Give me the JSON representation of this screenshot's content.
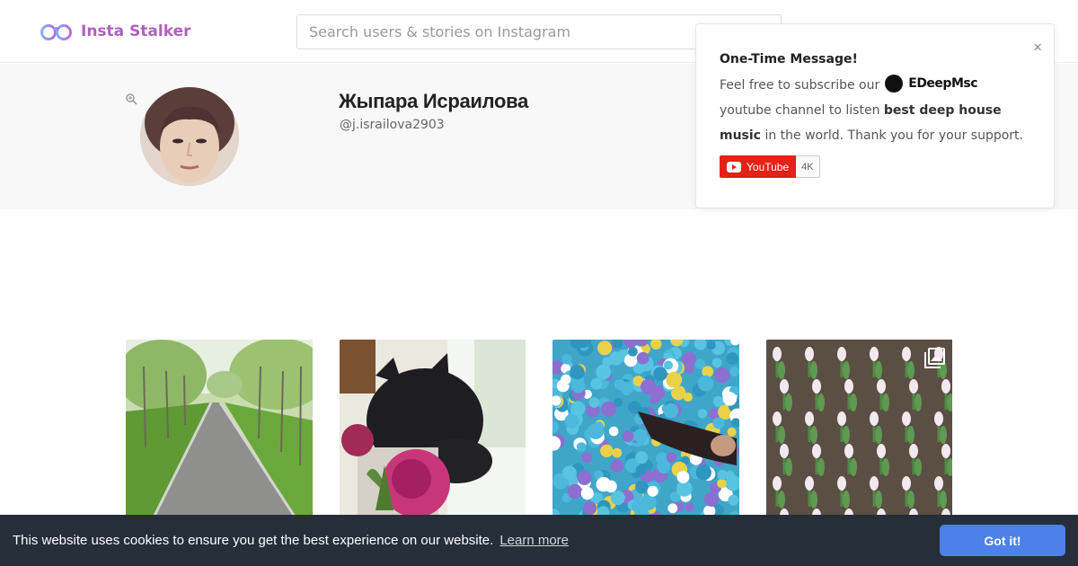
{
  "header": {
    "logo_text": "Insta Stalker",
    "search_placeholder": "Search users & stories on Instagram"
  },
  "profile": {
    "name": "Жыпара Исраилова",
    "handle": "@j.israilova2903"
  },
  "popup": {
    "title": "One-Time Message!",
    "text_before": "Feel free to subscribe our",
    "brand": "EDeepMsc",
    "text_after_brand": "youtube channel to listen",
    "bold_phrase": "best deep house music",
    "text_end": "in the world. Thank you for your support.",
    "close_symbol": "×",
    "youtube_label": "YouTube",
    "youtube_count": "4K"
  },
  "posts": [
    {
      "subject": "tree-lined path",
      "multi": false
    },
    {
      "subject": "black cat with roses",
      "multi": false
    },
    {
      "subject": "ball pit",
      "multi": false
    },
    {
      "subject": "tulips",
      "multi": true
    }
  ],
  "cookie": {
    "message": "This website uses cookies to ensure you get the best experience on our website.",
    "learn_more": "Learn more",
    "button": "Got it!"
  },
  "colors": {
    "brand_purple": "#b05fbf",
    "cookie_bg": "#252e39",
    "cookie_button": "#4b81e8",
    "youtube_red": "#e62117"
  }
}
